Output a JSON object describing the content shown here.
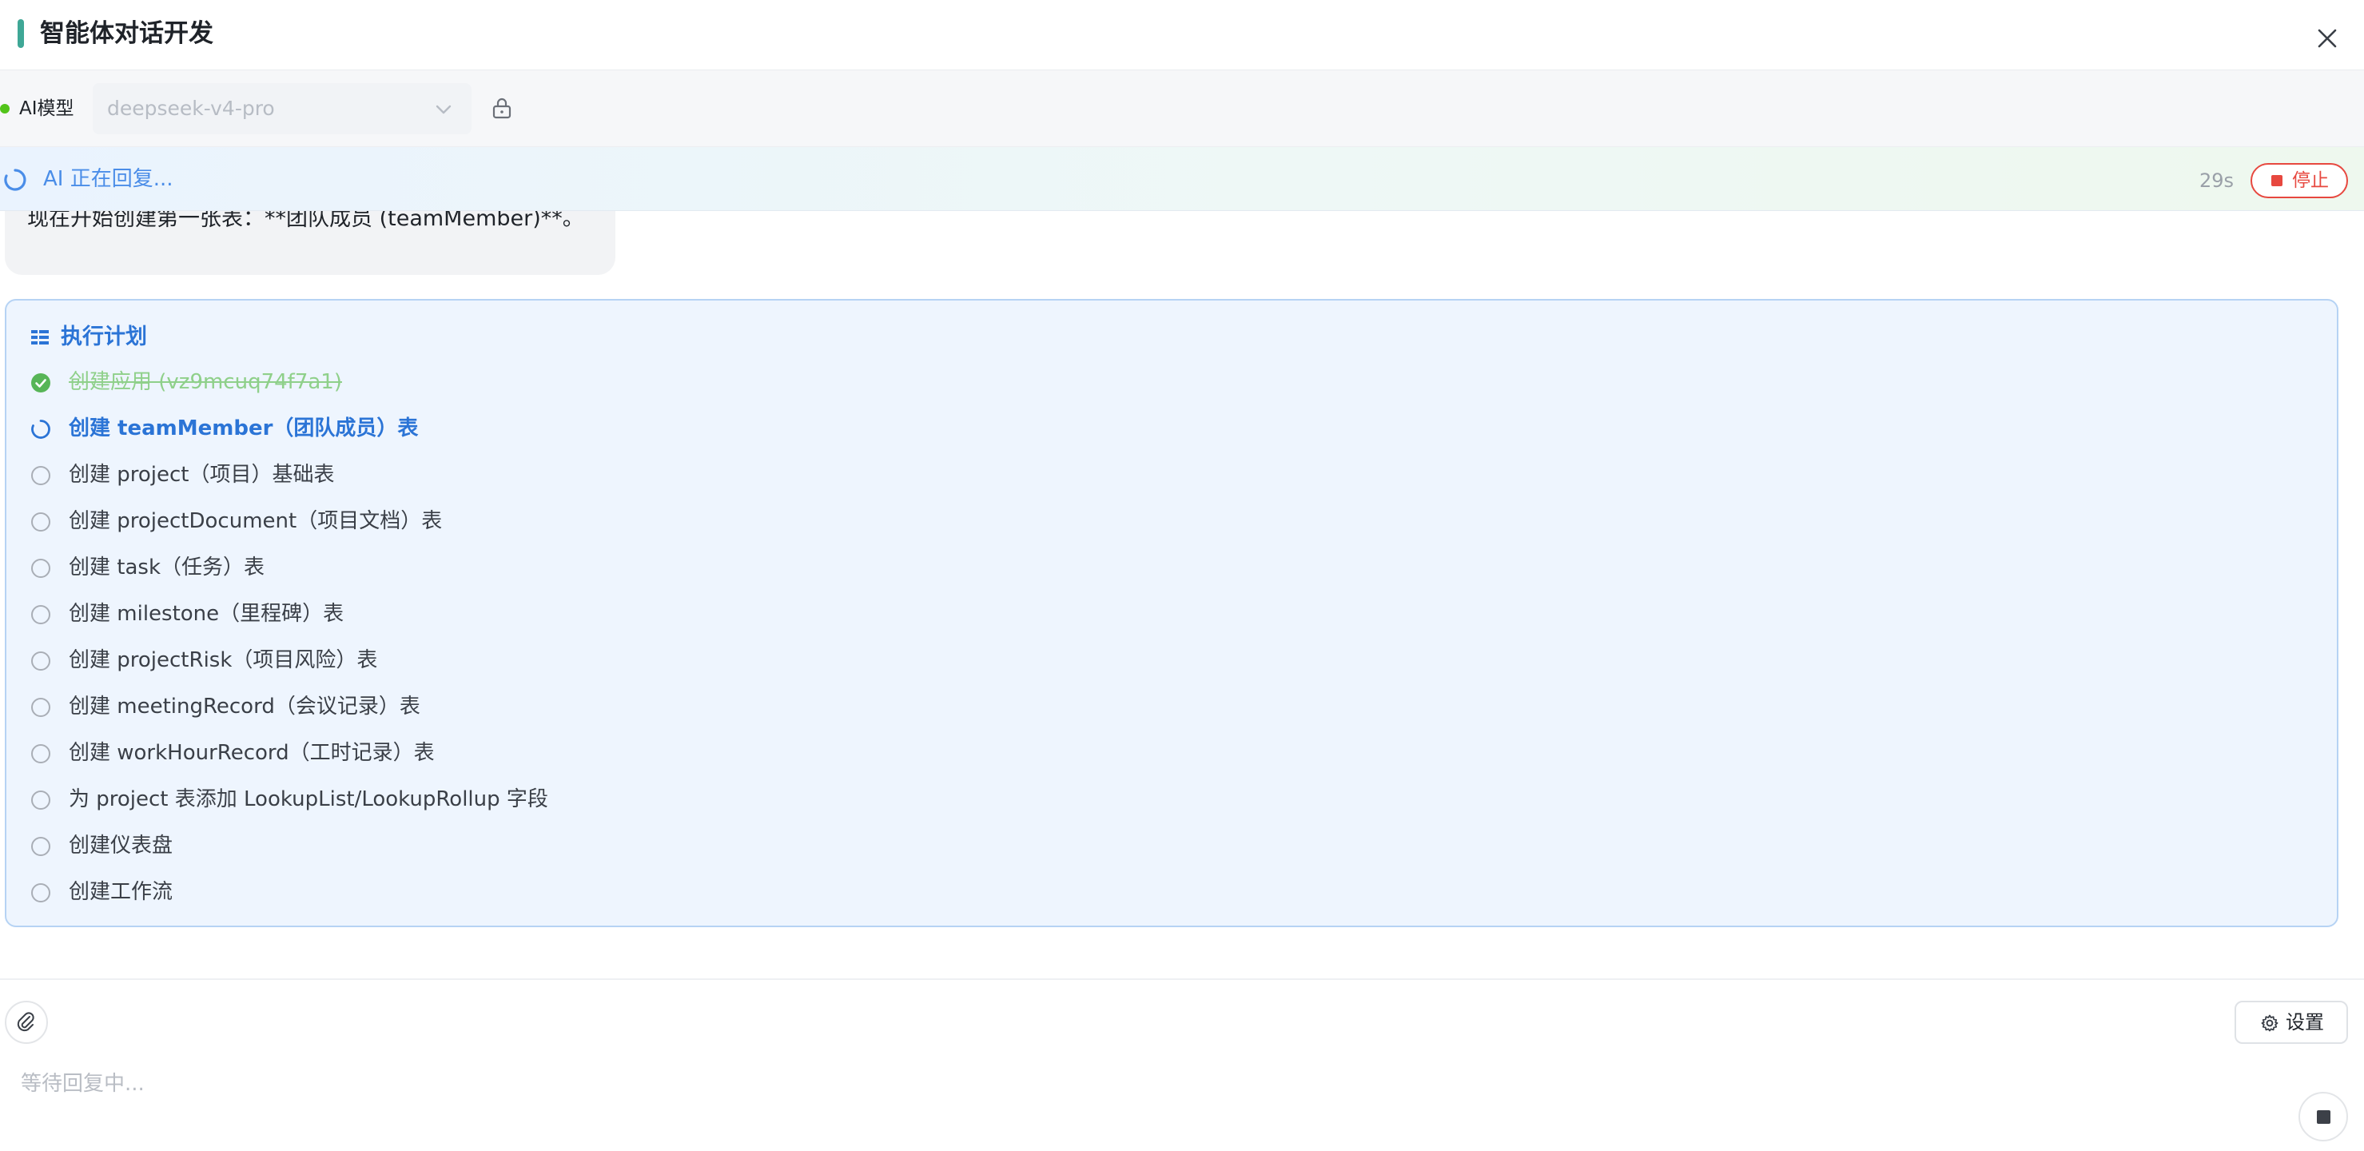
{
  "header": {
    "title": "智能体对话开发",
    "accent_color": "#3fa796",
    "close_icon": "close-icon"
  },
  "model_bar": {
    "label": "AI模型",
    "status_color": "#52c41a",
    "selected_model": "deepseek-v4-pro",
    "dropdown_icon": "chevron-down-icon",
    "lock_icon": "lock-icon"
  },
  "status": {
    "text": "AI 正在回复...",
    "elapsed": "29s",
    "stop_label": "停止",
    "spinner_icon": "spinner-icon",
    "danger_color": "#e7483f"
  },
  "message": {
    "text": "现在开始创建第一张表：**团队成员 (teamMember)**。"
  },
  "plan": {
    "title": "执行计划",
    "icon": "plan-list-icon",
    "accent_color": "#2b74d6",
    "items": [
      {
        "label": "创建应用 (vz9mcuq74f7a1)",
        "state": "done"
      },
      {
        "label": "创建 teamMember（团队成员）表",
        "state": "active"
      },
      {
        "label": "创建 project（项目）基础表",
        "state": "pending"
      },
      {
        "label": "创建 projectDocument（项目文档）表",
        "state": "pending"
      },
      {
        "label": "创建 task（任务）表",
        "state": "pending"
      },
      {
        "label": "创建 milestone（里程碑）表",
        "state": "pending"
      },
      {
        "label": "创建 projectRisk（项目风险）表",
        "state": "pending"
      },
      {
        "label": "创建 meetingRecord（会议记录）表",
        "state": "pending"
      },
      {
        "label": "创建 workHourRecord（工时记录）表",
        "state": "pending"
      },
      {
        "label": "为 project 表添加 LookupList/LookupRollup 字段",
        "state": "pending"
      },
      {
        "label": "创建仪表盘",
        "state": "pending"
      },
      {
        "label": "创建工作流",
        "state": "pending"
      }
    ]
  },
  "composer": {
    "attach_icon": "paperclip-icon",
    "settings_label": "设置",
    "settings_icon": "gear-icon",
    "placeholder": "等待回复中...",
    "stop_icon": "stop-icon"
  }
}
